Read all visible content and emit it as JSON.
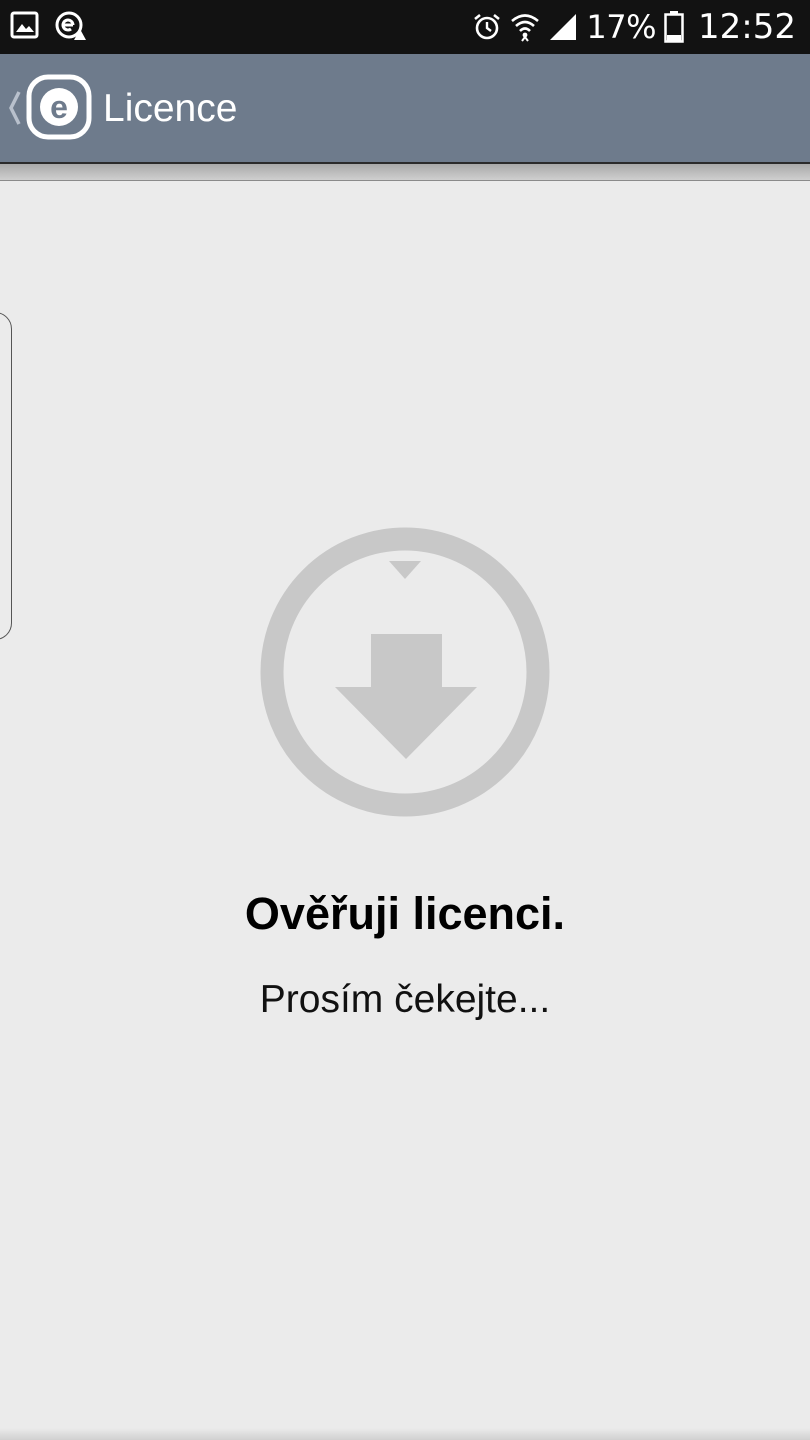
{
  "status_bar": {
    "battery_percent": "17%",
    "time": "12:52",
    "icons": [
      "gallery-icon",
      "eset-alert-icon",
      "alarm-icon",
      "wifi-icon",
      "signal-icon",
      "battery-icon"
    ]
  },
  "action_bar": {
    "title": "Licence",
    "logo_letter": "e",
    "background": "#6e7b8c"
  },
  "main": {
    "icon": "download-arrow-icon",
    "title": "Ověřuji licenci.",
    "subtitle": "Prosím čekejte..."
  },
  "colors": {
    "icon_gray": "#c8c8c8",
    "page_background": "#ebebeb"
  }
}
